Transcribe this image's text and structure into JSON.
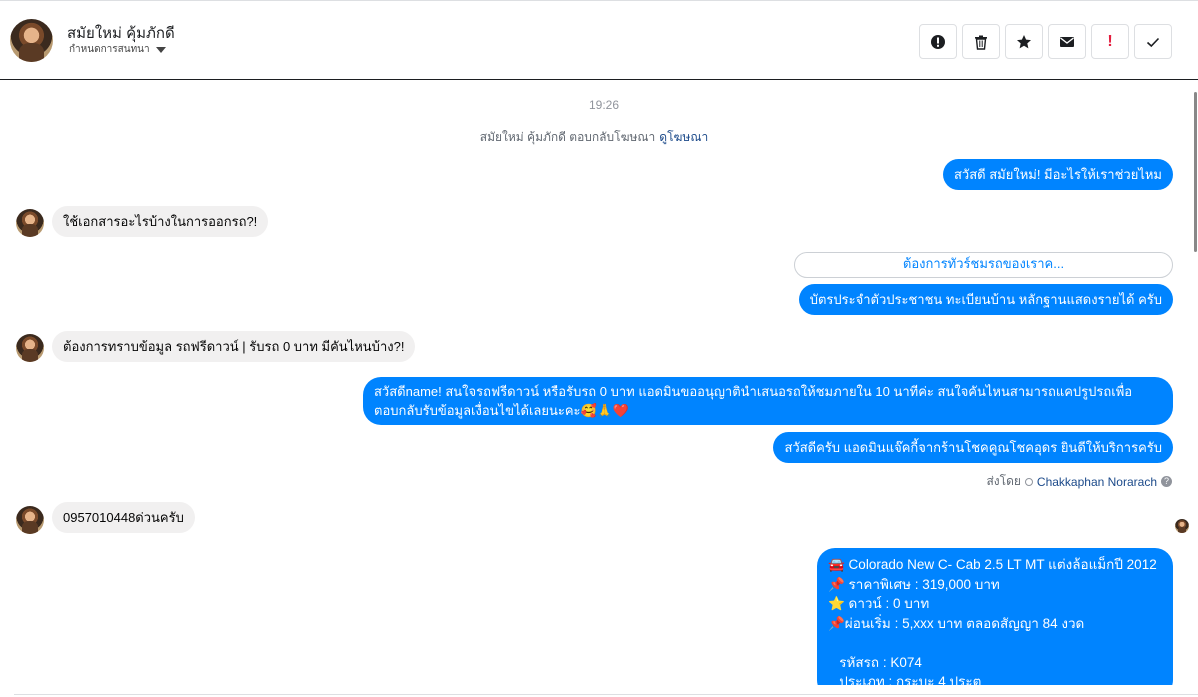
{
  "header": {
    "name": "สมัยใหม่ คุ้มภักดี",
    "subtitle": "กำหนดการสนทนา",
    "actions": [
      {
        "icon": "spam-alert-icon"
      },
      {
        "icon": "trash-icon"
      },
      {
        "icon": "star-icon"
      },
      {
        "icon": "mail-icon"
      },
      {
        "icon": "important-icon",
        "label": "!"
      },
      {
        "icon": "check-icon"
      }
    ]
  },
  "conversation": {
    "time": "19:26",
    "reply_note": "สมัยใหม่ คุ้มภักดี ตอบกลับโฆษณา",
    "reply_link": "ดูโฆษณา",
    "messages": [
      {
        "side": "out",
        "text": "สวัสดี สมัยใหม่! มีอะไรให้เราช่วยไหม"
      },
      {
        "side": "in",
        "text": "ใช้เอกสารอะไรบ้างในการออกรถ?!"
      },
      {
        "side": "quick_reply",
        "text": "ต้องการทัวร์ชมรถของเราค..."
      },
      {
        "side": "out",
        "text": "บัตรประจำตัวประชาชน ทะเบียนบ้าน หลักฐานแสดงรายได้ ครับ"
      },
      {
        "side": "in",
        "text": "ต้องการทราบข้อมูล รถฟรีดาวน์ | รับรถ 0 บาท มีคันไหนบ้าง?!"
      },
      {
        "side": "out",
        "line1": "สวัสดีname! สนใจรถฟรีดาวน์ หรือรับรถ 0 บาท แอดมินขออนุญาตินำเสนอรถให้ชมภายใน 10 นาทีค่ะ สนใจคันไหนสามารถแคปรูปรถเพื่อ",
        "line2": "ตอบกลับรับข้อมูลเงื่อนไขได้เลยนะคะ🥰🙏❤️"
      },
      {
        "side": "out",
        "text": "สวัสดีครับ แอดมินแจ๊คกี้จากร้านโชคคูณโชคอุดร ยินดีให้บริการครับ"
      },
      {
        "side": "in",
        "text": "0957010448ด่วนครับ"
      }
    ],
    "sent_by_label": "ส่งโดย",
    "sent_by_name": "Chakkaphan Norarach",
    "help": "?",
    "card": {
      "lines": [
        "🚘 Colorado New C- Cab 2.5 LT MT แต่งล้อแม็กปี 2012",
        "📌 ราคาพิเศษ : 319,000 บาท",
        "⭐ ดาวน์ : 0 บาท",
        "📌ผ่อนเริ่ม : 5,xxx บาท ตลอดสัญญา 84 งวด",
        "",
        "   รหัสรถ : K074",
        "   ประเภท : กระบะ 4 ประตู"
      ]
    }
  }
}
